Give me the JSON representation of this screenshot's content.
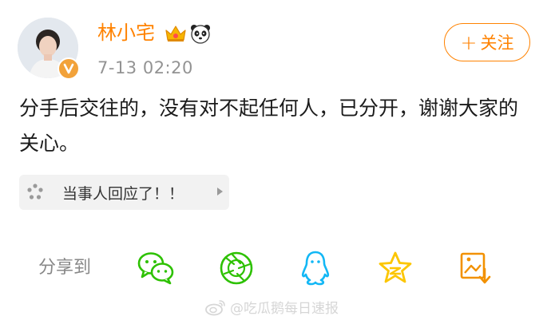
{
  "post": {
    "username": "林小宅",
    "timestamp": "7-13 02:20",
    "follow_label": "关注",
    "text": "分手后交往的，没有对不起任何人，已分开，谢谢大家的关心。",
    "link_card": {
      "text": "当事人回应了！！",
      "icon": "dots-icon"
    },
    "badges": [
      "crown-icon",
      "panda-icon",
      "verified-v-icon"
    ]
  },
  "share": {
    "label": "分享到",
    "targets": [
      "wechat-icon",
      "moments-icon",
      "qq-icon",
      "qzone-icon",
      "save-image-icon"
    ]
  },
  "watermark": {
    "text": "@吃瓜鹅每日速报"
  },
  "colors": {
    "accent": "#ff8200",
    "text": "#1b1b1b",
    "muted": "#939393"
  }
}
